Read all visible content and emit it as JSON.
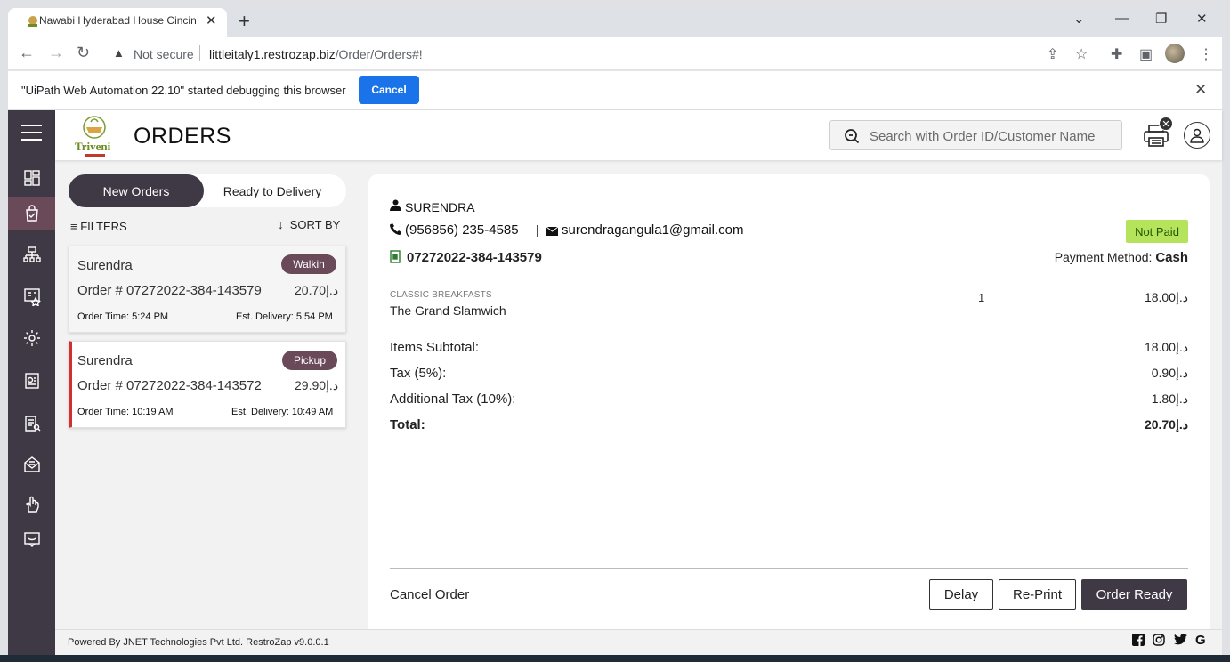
{
  "browser": {
    "tab_title": "Nawabi Hyderabad House Cincin",
    "new_tab_symbol": "+",
    "security_label": "Not secure",
    "url_host": "littleitaly1.restrozap.biz",
    "url_path": "/Order/Orders#!"
  },
  "infobar": {
    "message": "\"UiPath Web Automation 22.10\" started debugging this browser",
    "cancel_label": "Cancel"
  },
  "header": {
    "page_title": "ORDERS",
    "logo_text": "Triveni",
    "search_placeholder": "Search with Order ID/Customer Name"
  },
  "orders_list": {
    "tabs": [
      {
        "label": "New Orders",
        "active": true
      },
      {
        "label": "Ready to Delivery",
        "active": false
      }
    ],
    "filters_label": "FILTERS",
    "sort_label": "SORT BY",
    "cards": [
      {
        "name": "Surendra",
        "type": "Walkin",
        "order_label": "Order # 07272022-384-143579",
        "amount": "20.70د.إ",
        "order_time": "Order Time: 5:24 PM",
        "est_delivery": "Est. Delivery: 5:54 PM"
      },
      {
        "name": "Surendra",
        "type": "Pickup",
        "order_label": "Order # 07272022-384-143572",
        "amount": "29.90د.إ",
        "order_time": "Order Time: 10:19 AM",
        "est_delivery": "Est. Delivery: 10:49 AM"
      }
    ]
  },
  "order_detail": {
    "customer_name": "SURENDRA",
    "phone": "(956856) 235-4585",
    "separator": "|",
    "email": "surendragangula1@gmail.com",
    "order_id": "07272022-384-143579",
    "payment_status": "Not Paid",
    "payment_method_label": "Payment Method:",
    "payment_method": "Cash",
    "items": [
      {
        "category": "CLASSIC BREAKFASTS",
        "name": "The Grand Slamwich",
        "qty": "1",
        "price": "18.00د.إ"
      }
    ],
    "summary": [
      {
        "label": "Items Subtotal:",
        "value": "18.00د.إ"
      },
      {
        "label": "Tax (5%):",
        "value": "0.90د.إ"
      },
      {
        "label": "Additional Tax (10%):",
        "value": "1.80د.إ"
      },
      {
        "label": "Total:",
        "value": "20.70د.إ"
      }
    ],
    "cancel_label": "Cancel Order",
    "delay_label": "Delay",
    "reprint_label": "Re-Print",
    "ready_label": "Order Ready"
  },
  "footer": {
    "text": "Powered By JNET Technologies Pvt Ltd. RestroZap v9.0.0.1",
    "social": [
      "facebook-icon",
      "instagram-icon",
      "twitter-icon",
      "google-icon"
    ]
  },
  "colors": {
    "sidebar": "#3e3945",
    "accent": "#6a4959",
    "paid_badge": "#b6e35c",
    "pickup_border": "#d32f2f"
  }
}
